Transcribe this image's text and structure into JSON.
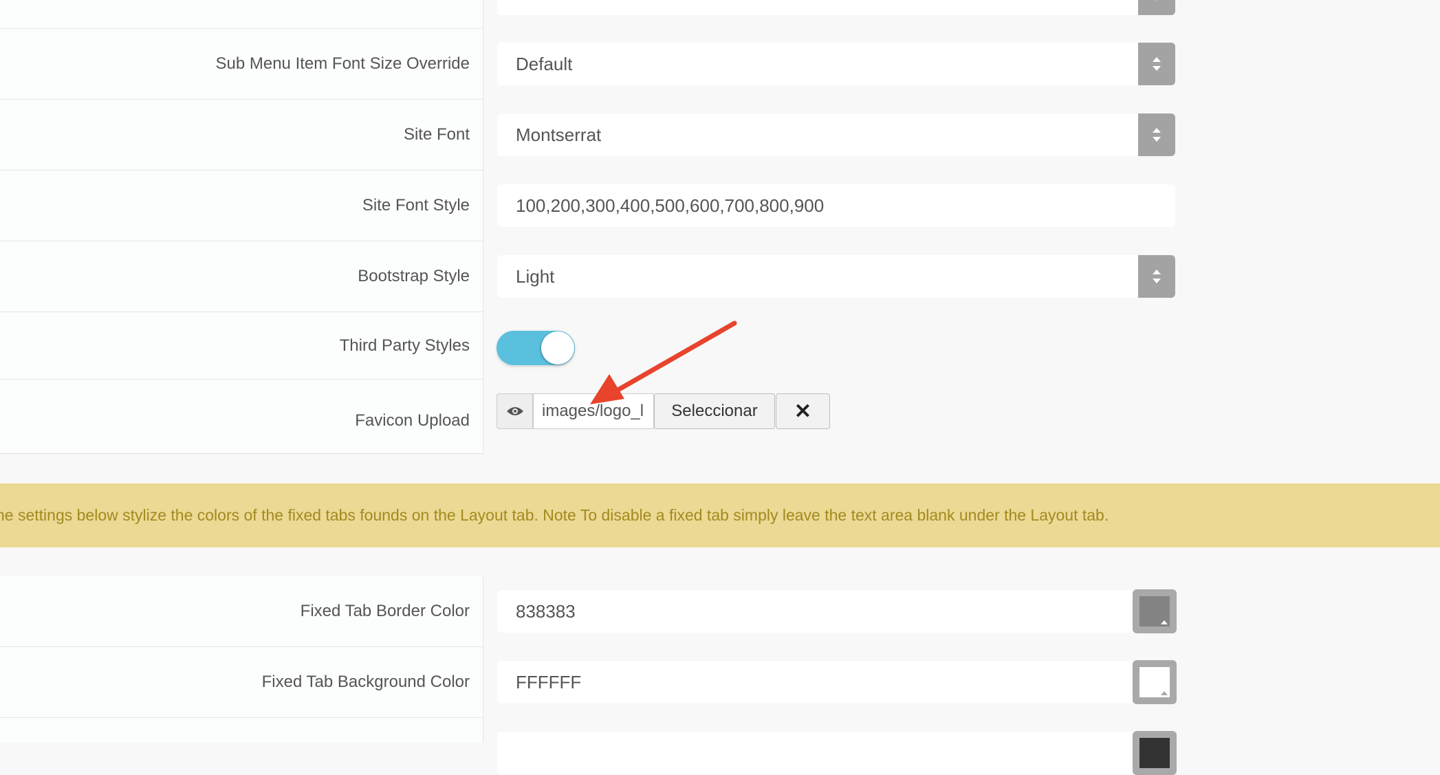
{
  "rows": {
    "sub_menu_font_size": {
      "label": "Sub Menu Item Font Size Override",
      "value": "Default"
    },
    "site_font": {
      "label": "Site Font",
      "value": "Montserrat"
    },
    "site_font_style": {
      "label": "Site Font Style",
      "value": "100,200,300,400,500,600,700,800,900"
    },
    "bootstrap_style": {
      "label": "Bootstrap Style",
      "value": "Light"
    },
    "third_party_styles": {
      "label": "Third Party Styles",
      "enabled": true
    },
    "favicon_upload": {
      "label": "Favicon Upload",
      "path": "images/logo_l",
      "select_label": "Seleccionar",
      "clear_label": "✕"
    }
  },
  "notice": {
    "text": "he settings below stylize the colors of the fixed tabs founds on the Layout tab. Note To disable a fixed tab simply leave the text area blank under the Layout tab."
  },
  "color_rows": {
    "fixed_tab_border": {
      "label": "Fixed Tab Border Color",
      "value": "838383",
      "swatch": "#838383"
    },
    "fixed_tab_background": {
      "label": "Fixed Tab Background Color",
      "value": "FFFFFF",
      "swatch": "#ffffff"
    },
    "next_swatch": "#333333"
  },
  "colors": {
    "toggle_on": "#5bc0de",
    "notice_bg": "#ebd994",
    "notice_text": "#a38a1f",
    "arrow": "#e8432c"
  },
  "icons": {
    "select_arrows": "chevron-up-down-icon",
    "preview": "eye-icon",
    "clear": "close-icon",
    "annotation": "red-arrow-annotation"
  }
}
